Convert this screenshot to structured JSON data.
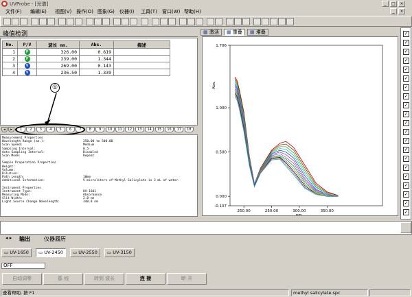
{
  "window": {
    "title": "UVProbe - [光谱]",
    "controls": [
      "_",
      "□",
      "×"
    ]
  },
  "menu": [
    "文件(F)",
    "编辑(E)",
    "视图(V)",
    "操作(O)",
    "图象(G)",
    "仪器(I)",
    "工具(T)",
    "窗口(W)",
    "帮助(H)"
  ],
  "left_panel": {
    "title": "峰值检测"
  },
  "peak_table": {
    "headers": [
      "No.",
      "P/V",
      "波长 nm.",
      "Abs.",
      "描述"
    ],
    "rows": [
      {
        "no": "1",
        "pv": "P",
        "pv_color": "#1f9d3a",
        "wl": "326.00",
        "abs": "0.619"
      },
      {
        "no": "2",
        "pv": "P",
        "pv_color": "#1f9d3a",
        "wl": "239.00",
        "abs": "1.344"
      },
      {
        "no": "3",
        "pv": "V",
        "pv_color": "#1f4fbf",
        "wl": "269.00",
        "abs": "0.143"
      },
      {
        "no": "4",
        "pv": "V",
        "pv_color": "#1f4fbf",
        "wl": "236.50",
        "abs": "1.339"
      }
    ]
  },
  "page_tabs": [
    "1",
    "2",
    "3",
    "4",
    "5",
    "6",
    "7",
    "8",
    "9",
    "10",
    "11",
    "12",
    "13",
    "14",
    "15",
    "16",
    "17",
    "18"
  ],
  "callout": "①",
  "details": [
    [
      "Measurement Properties",
      ""
    ],
    [
      "Wavelength Range (nm.):",
      "250.00 to 500.00"
    ],
    [
      "Scan Speed:",
      "Medium"
    ],
    [
      "Sampling Interval:",
      "0.5"
    ],
    [
      "Auto Sampling Interval:",
      "Disabled"
    ],
    [
      "Scan Mode:",
      "Repeat"
    ],
    [
      "",
      ""
    ],
    [
      "Sample Preparation Properties",
      ""
    ],
    [
      "Weight:",
      ""
    ],
    [
      "Volume:",
      ""
    ],
    [
      "Dilution:",
      ""
    ],
    [
      "Path Length:",
      "10mm"
    ],
    [
      "Additional Information:",
      "5 microliters of Methyl Salicylate in 3 mL of water."
    ],
    [
      "",
      ""
    ],
    [
      "Instrument Properties",
      ""
    ],
    [
      "Instrument Type:",
      "UV-1601"
    ],
    [
      "Measuring Mode:",
      "Absorbance"
    ],
    [
      "Slit Width:",
      "2.0 nm"
    ],
    [
      "Light Source Change Wavelength:",
      "340.8 nm"
    ]
  ],
  "right_tabs": [
    "激活",
    "重叠",
    "堆叠"
  ],
  "output_tabs": [
    "输出",
    "仪器履历"
  ],
  "instruments": [
    "UV-1650",
    "UV-2450",
    "UV-2550",
    "UV-3150"
  ],
  "off_label": "OFF",
  "bottom_buttons": [
    "自动调零",
    "基 线",
    "转到 波长",
    "连 接",
    "断 开"
  ],
  "status": {
    "left": "查看帮助, 按 F1",
    "file": "methyl salicylate.spc"
  },
  "chart_data": {
    "type": "line",
    "xlabel": "nm.",
    "ylabel": "Abs.",
    "xlim": [
      225,
      500
    ],
    "ylim": [
      -0.107,
      1.706
    ],
    "x_ticks": [
      250,
      300,
      350,
      400
    ],
    "x_tick_labels": [
      "250.00",
      "250.00",
      "300.00",
      "350.00"
    ],
    "y_ticks": [
      -0.107,
      0.0,
      0.5,
      1.0,
      1.706
    ],
    "y_tick_labels": [
      "-0.107",
      "0.000",
      "0.500",
      "1.000",
      "1.706"
    ],
    "grid": false,
    "line_colors": [
      "#c00000",
      "#7f3f00",
      "#3fae3f",
      "#30c0c0",
      "#3050c0",
      "#8050c0",
      "#c050a0",
      "#00a080",
      "#a0a000",
      "#000080",
      "#b06030",
      "#20a0d0"
    ],
    "series": [
      {
        "x": [
          234,
          238,
          242,
          250,
          260,
          269,
          280,
          300,
          315,
          326,
          340,
          360,
          380,
          400,
          420
        ],
        "y": [
          1.35,
          1.3,
          1.2,
          0.95,
          0.45,
          0.143,
          0.32,
          0.52,
          0.6,
          0.62,
          0.55,
          0.35,
          0.15,
          0.05,
          0.01
        ]
      },
      {
        "x": [
          234,
          238,
          242,
          250,
          260,
          269,
          280,
          300,
          315,
          326,
          340,
          360,
          380,
          400,
          420
        ],
        "y": [
          1.33,
          1.28,
          1.18,
          0.93,
          0.44,
          0.14,
          0.31,
          0.51,
          0.58,
          0.59,
          0.52,
          0.32,
          0.13,
          0.04,
          0.01
        ]
      },
      {
        "x": [
          234,
          238,
          242,
          250,
          260,
          269,
          280,
          300,
          315,
          326,
          340,
          360,
          380,
          400,
          420
        ],
        "y": [
          1.31,
          1.26,
          1.16,
          0.91,
          0.43,
          0.14,
          0.31,
          0.5,
          0.56,
          0.56,
          0.49,
          0.29,
          0.11,
          0.03,
          0.0
        ]
      },
      {
        "x": [
          234,
          238,
          242,
          250,
          260,
          269,
          280,
          300,
          315,
          326,
          340,
          360,
          380,
          400,
          420
        ],
        "y": [
          1.29,
          1.24,
          1.14,
          0.89,
          0.42,
          0.14,
          0.3,
          0.49,
          0.54,
          0.53,
          0.46,
          0.26,
          0.1,
          0.03,
          0.0
        ]
      },
      {
        "x": [
          234,
          238,
          242,
          250,
          260,
          269,
          280,
          300,
          315,
          326,
          340,
          360,
          380,
          400,
          420
        ],
        "y": [
          1.27,
          1.22,
          1.12,
          0.87,
          0.41,
          0.13,
          0.3,
          0.48,
          0.52,
          0.5,
          0.43,
          0.23,
          0.08,
          0.02,
          0.0
        ]
      },
      {
        "x": [
          234,
          238,
          242,
          250,
          260,
          269,
          280,
          300,
          315,
          326,
          340,
          360,
          380,
          400,
          420
        ],
        "y": [
          1.25,
          1.2,
          1.1,
          0.85,
          0.4,
          0.13,
          0.29,
          0.47,
          0.5,
          0.47,
          0.4,
          0.2,
          0.07,
          0.02,
          0.0
        ]
      },
      {
        "x": [
          234,
          238,
          242,
          250,
          260,
          269,
          280,
          300,
          315,
          326,
          340,
          360,
          380,
          400,
          420
        ],
        "y": [
          1.23,
          1.18,
          1.08,
          0.83,
          0.39,
          0.13,
          0.29,
          0.46,
          0.48,
          0.44,
          0.37,
          0.18,
          0.06,
          0.01,
          0.0
        ]
      },
      {
        "x": [
          234,
          238,
          242,
          250,
          260,
          269,
          280,
          300,
          315,
          326,
          340,
          360,
          380,
          400,
          420
        ],
        "y": [
          1.21,
          1.16,
          1.06,
          0.81,
          0.38,
          0.12,
          0.28,
          0.45,
          0.46,
          0.42,
          0.34,
          0.16,
          0.05,
          0.01,
          0.0
        ]
      },
      {
        "x": [
          234,
          238,
          242,
          250,
          260,
          269,
          280,
          300,
          315,
          326,
          340,
          360,
          380,
          400,
          420
        ],
        "y": [
          1.19,
          1.14,
          1.04,
          0.79,
          0.37,
          0.12,
          0.28,
          0.44,
          0.45,
          0.4,
          0.31,
          0.14,
          0.04,
          0.01,
          0.0
        ]
      },
      {
        "x": [
          234,
          238,
          242,
          250,
          260,
          269,
          280,
          300,
          315,
          326,
          340,
          360,
          380,
          400,
          420
        ],
        "y": [
          1.17,
          1.12,
          1.02,
          0.77,
          0.36,
          0.12,
          0.27,
          0.43,
          0.44,
          0.38,
          0.28,
          0.12,
          0.03,
          0.0,
          0.0
        ]
      },
      {
        "x": [
          234,
          238,
          242,
          250,
          260,
          269,
          280,
          300,
          315,
          326,
          340,
          360,
          380,
          400,
          420
        ],
        "y": [
          1.15,
          1.1,
          1.0,
          0.75,
          0.35,
          0.11,
          0.27,
          0.42,
          0.43,
          0.36,
          0.26,
          0.1,
          0.03,
          0.0,
          0.0
        ]
      },
      {
        "x": [
          234,
          238,
          242,
          250,
          260,
          269,
          280,
          300,
          315,
          326,
          340,
          360,
          380,
          400,
          420
        ],
        "y": [
          1.13,
          1.08,
          0.98,
          0.73,
          0.34,
          0.11,
          0.26,
          0.41,
          0.42,
          0.34,
          0.24,
          0.09,
          0.02,
          0.0,
          0.0
        ]
      }
    ]
  }
}
